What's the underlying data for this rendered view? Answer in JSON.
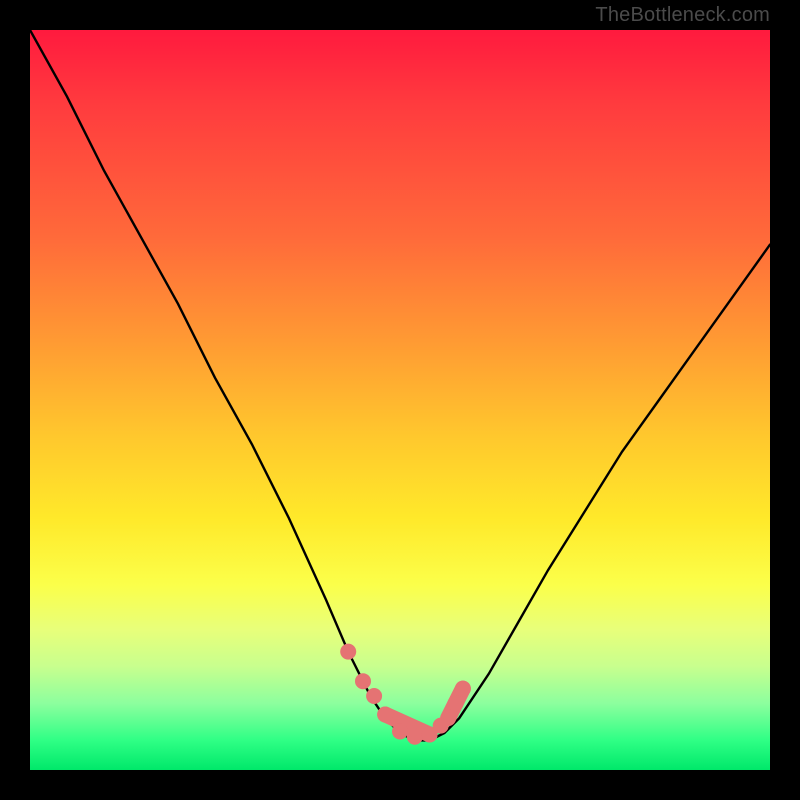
{
  "attribution": "TheBottleneck.com",
  "chart_data": {
    "type": "line",
    "title": "",
    "xlabel": "",
    "ylabel": "",
    "xlim": [
      0,
      100
    ],
    "ylim": [
      0,
      100
    ],
    "series": [
      {
        "name": "bottleneck-curve",
        "x": [
          0,
          5,
          10,
          15,
          20,
          25,
          30,
          35,
          40,
          43,
          46,
          48,
          50,
          52,
          54,
          56,
          58,
          62,
          66,
          70,
          75,
          80,
          85,
          90,
          95,
          100
        ],
        "values": [
          100,
          91,
          81,
          72,
          63,
          53,
          44,
          34,
          23,
          16,
          10,
          7,
          5,
          4,
          4,
          5,
          7,
          13,
          20,
          27,
          35,
          43,
          50,
          57,
          64,
          71
        ]
      },
      {
        "name": "marker-dots",
        "x": [
          43,
          45,
          46.5,
          48,
          50,
          52,
          54,
          55.5,
          57.5,
          58.5
        ],
        "values": [
          16,
          12,
          10,
          7.5,
          5.2,
          4.5,
          4.8,
          6,
          9,
          11
        ]
      }
    ],
    "colors": {
      "curve": "#000000",
      "markers": "#e57373"
    }
  }
}
